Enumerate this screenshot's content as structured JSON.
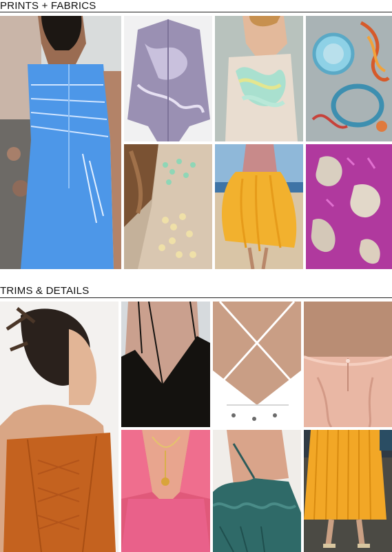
{
  "sections": {
    "prints_fabrics": {
      "title": "PRINTS + FABRICS",
      "images": [
        {
          "name": "blue-pleated-dress-photo",
          "icon": "photo"
        },
        {
          "name": "lilac-metallic-cape-photo",
          "icon": "photo"
        },
        {
          "name": "sheer-ruffle-top-photo",
          "icon": "photo"
        },
        {
          "name": "embroidered-textile-photo",
          "icon": "photo"
        },
        {
          "name": "beaded-sheer-back-photo",
          "icon": "photo"
        },
        {
          "name": "yellow-tulle-skirt-photo",
          "icon": "photo"
        },
        {
          "name": "pink-foil-fabric-photo",
          "icon": "photo"
        }
      ]
    },
    "trims_details": {
      "title": "TRIMS & DETAILS",
      "images": [
        {
          "name": "lace-up-back-top-photo",
          "icon": "photo"
        },
        {
          "name": "black-strappy-top-photo",
          "icon": "photo"
        },
        {
          "name": "white-cross-strap-top-photo",
          "icon": "photo"
        },
        {
          "name": "pink-satin-back-photo",
          "icon": "photo"
        },
        {
          "name": "pink-sheer-dress-photo",
          "icon": "photo"
        },
        {
          "name": "teal-ruffle-shoulder-photo",
          "icon": "photo"
        },
        {
          "name": "yellow-pleated-skirt-photo",
          "icon": "photo"
        }
      ]
    }
  },
  "colors": {
    "text": "#111111",
    "rule": "#222222",
    "background": "#ffffff"
  }
}
